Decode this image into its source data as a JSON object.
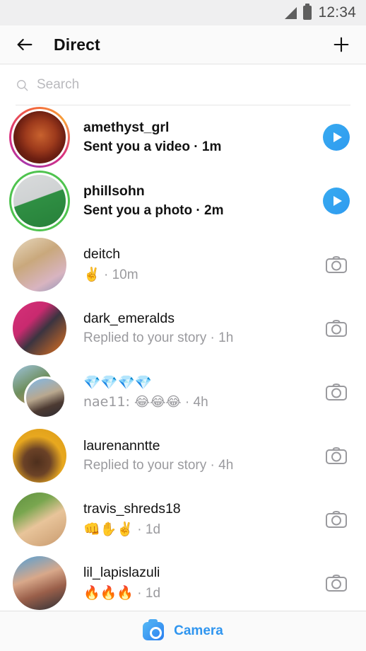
{
  "status_bar": {
    "time": "12:34",
    "signal_icon": "signal-triangle-icon",
    "battery_icon": "battery-icon"
  },
  "header": {
    "back_icon": "arrow-left-icon",
    "title": "Direct",
    "new_message_icon": "plus-icon"
  },
  "search": {
    "placeholder": "Search",
    "icon": "search-icon",
    "value": ""
  },
  "colors": {
    "accent_blue": "#2f95ef",
    "play_blue": "#2f9bf0",
    "close_friends_green": "#4fc34f",
    "unread_text": "#121212",
    "muted_text": "#9a9a9e"
  },
  "conversations": [
    {
      "username": "amethyst_grl",
      "preview": "Sent you a video",
      "timestamp": "1m",
      "unread": true,
      "action_icon": "play-button-icon",
      "ring": "gradient",
      "avatar": "amethyst_grl-avatar",
      "type": "direct"
    },
    {
      "username": "phillsohn",
      "preview": "Sent you a photo",
      "timestamp": "2m",
      "unread": true,
      "action_icon": "play-button-icon",
      "ring": "green",
      "avatar": "phillsohn-avatar",
      "type": "direct"
    },
    {
      "username": "deitch",
      "preview": "✌️",
      "timestamp": "10m",
      "unread": false,
      "action_icon": "camera-outline-icon",
      "ring": "none",
      "avatar": "deitch-avatar",
      "type": "direct"
    },
    {
      "username": "dark_emeralds",
      "preview": "Replied to your story",
      "timestamp": "1h",
      "unread": false,
      "action_icon": "camera-outline-icon",
      "ring": "none",
      "avatar": "dark_emeralds-avatar",
      "type": "direct"
    },
    {
      "username": "💎💎💎💎",
      "preview": "nae11: 😂😂😂",
      "timestamp": "4h",
      "unread": false,
      "action_icon": "camera-outline-icon",
      "ring": "none",
      "avatar": "group-avatar",
      "type": "group"
    },
    {
      "username": "laurenanntte",
      "preview": "Replied to your story",
      "timestamp": "4h",
      "unread": false,
      "action_icon": "camera-outline-icon",
      "ring": "none",
      "avatar": "laurenanntte-avatar",
      "type": "direct"
    },
    {
      "username": "travis_shreds18",
      "preview": "👊✋✌️",
      "timestamp": "1d",
      "unread": false,
      "action_icon": "camera-outline-icon",
      "ring": "none",
      "avatar": "travis_shreds18-avatar",
      "type": "direct"
    },
    {
      "username": "lil_lapislazuli",
      "preview": "🔥🔥🔥",
      "timestamp": "1d",
      "unread": false,
      "action_icon": "camera-outline-icon",
      "ring": "none",
      "avatar": "lil_lapislazuli-avatar",
      "type": "direct"
    }
  ],
  "bottom_bar": {
    "camera_label": "Camera",
    "camera_icon": "camera-filled-icon"
  }
}
